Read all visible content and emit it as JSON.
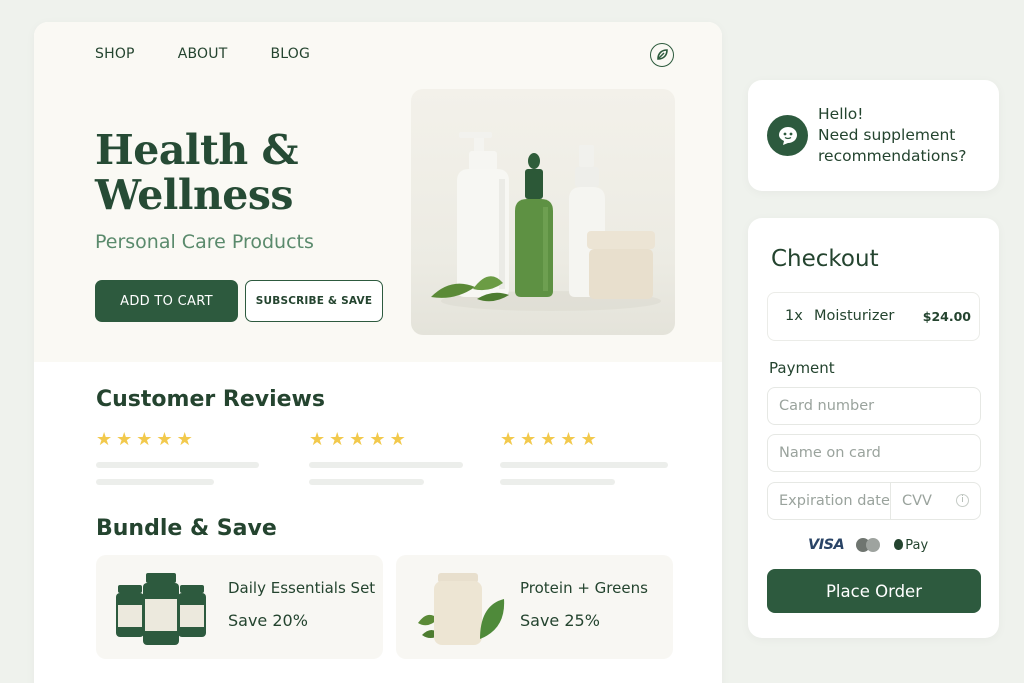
{
  "nav": {
    "items": [
      "SHOP",
      "ABOUT",
      "BLOG"
    ]
  },
  "hero": {
    "title": "Health & Wellness",
    "subtitle": "Personal Care Products",
    "primary_button": "ADD TO CART",
    "secondary_button": "SUBSCRIBE & SAVE"
  },
  "reviews": {
    "title": "Customer Reviews",
    "items": [
      {
        "rating": 5
      },
      {
        "rating": 5
      },
      {
        "rating": 5
      }
    ]
  },
  "bundles": {
    "title": "Bundle & Save",
    "items": [
      {
        "name": "Daily Essentials Set",
        "save": "Save 20%"
      },
      {
        "name": "Protein + Greens",
        "save": "Save 25%"
      }
    ]
  },
  "chat": {
    "line1": "Hello!",
    "line2": "Need supplement recommendations?"
  },
  "checkout": {
    "title": "Checkout",
    "item": {
      "qty": "1x",
      "name": "Moisturizer",
      "price": "$24.00"
    },
    "payment_label": "Payment",
    "card_number_placeholder": "Card number",
    "name_placeholder": "Name on card",
    "expiry_placeholder": "Expiration date",
    "cvv_placeholder": "CVV",
    "visa_label": "VISA",
    "applepay_label": "Pay",
    "place_order": "Place Order"
  },
  "colors": {
    "brand_green": "#2d5a3e",
    "star": "#f2c94c",
    "background": "#eff2ed"
  }
}
